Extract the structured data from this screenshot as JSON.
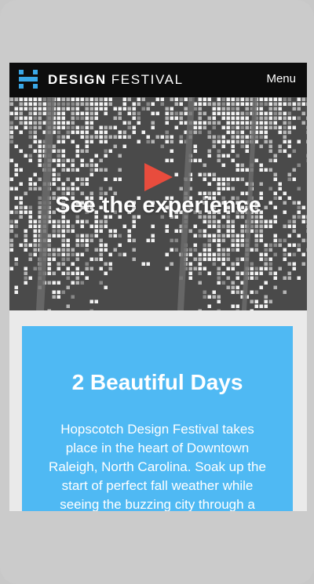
{
  "header": {
    "brand_bold": "DESIGN",
    "brand_light": "FESTIVAL",
    "menu_label": "Menu",
    "logo_icon": "hopscotch-h-logo-icon",
    "logo_color": "#3aa8e8"
  },
  "hero": {
    "play_icon": "play-icon",
    "play_color": "#e84c3d",
    "title": "See the experience"
  },
  "intro_card": {
    "heading": "2 Beautiful Days",
    "body": "Hopscotch Design Festival takes place in the heart of Downtown Raleigh, North Carolina. Soak up the start of perfect fall weather while seeing the buzzing city through a",
    "background_color": "#4fb9f3"
  }
}
